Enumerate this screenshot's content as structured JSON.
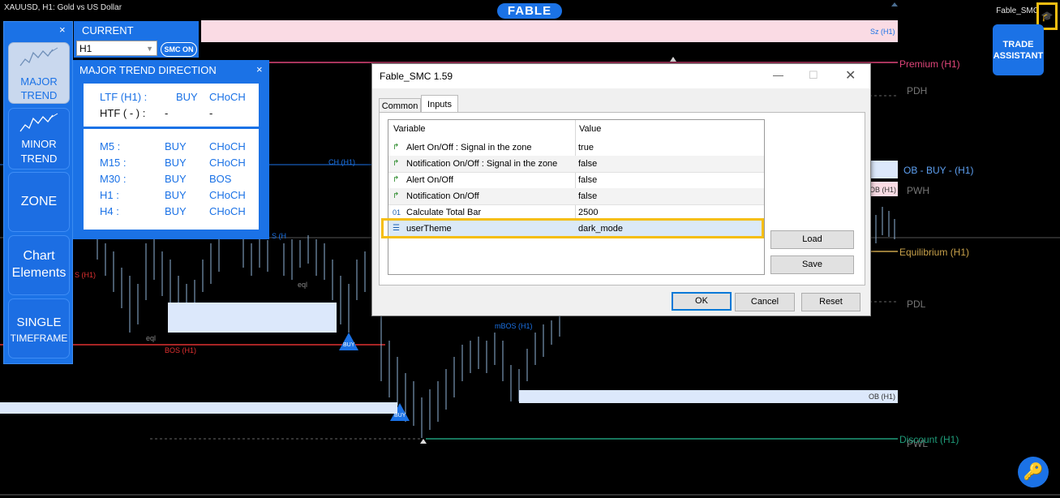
{
  "chart_header": {
    "symbol": "XAUUSD, H1:  Gold vs US Dollar",
    "indicator_name": "Fable_SMC"
  },
  "brand": "FABLE",
  "trade_assistant": "TRADE ASSISTANT",
  "sidebar": {
    "close": "×",
    "buttons": [
      {
        "label1": "MAJOR",
        "label2": "TREND"
      },
      {
        "label1": "MINOR",
        "label2": "TREND"
      },
      {
        "label1": "ZONE"
      },
      {
        "label1": "Chart",
        "label2": "Elements"
      },
      {
        "label1": "SINGLE",
        "label2": "TIMEFRAME"
      }
    ]
  },
  "current_panel": {
    "title": "CURRENT",
    "timeframe": "H1",
    "toggle": "SMC ON"
  },
  "major_trend": {
    "title": "MAJOR TREND DIRECTION",
    "close": "×",
    "top_rows": [
      {
        "tf": "LTF (H1) :",
        "dir": "BUY",
        "type": "CHoCH"
      },
      {
        "tf": "HTF ( - ) :",
        "dir": "-",
        "type": "-"
      }
    ],
    "rows": [
      {
        "tf": "M5 :",
        "dir": "BUY",
        "type": "CHoCH"
      },
      {
        "tf": "M15 :",
        "dir": "BUY",
        "type": "CHoCH"
      },
      {
        "tf": "M30 :",
        "dir": "BUY",
        "type": "BOS"
      },
      {
        "tf": "H1 :",
        "dir": "BUY",
        "type": "CHoCH"
      },
      {
        "tf": "H4 :",
        "dir": "BUY",
        "type": "CHoCH"
      }
    ]
  },
  "chart_labels": {
    "sz": "Sz (H1)",
    "premium": "Premium (H1)",
    "pdh": "PDH",
    "ob_buy": "OB - BUY -  (H1)",
    "ob_h1_small": "OB (H1)",
    "pwh": "PWH",
    "equilibrium": "Equilibrium (H1)",
    "pdl": "PDL",
    "ob_h1": "OB (H1)",
    "discount": "Discount (H1)",
    "pwl": "PWL",
    "ch_h1": "CH (H1)",
    "s_h1": "S (H1)",
    "bos_h1": "BOS (H1)",
    "mbos_h1": "mBOS (H1)",
    "eql1": "eql",
    "eql2": "eql",
    "buy1": "BUY",
    "buy2": "BUY",
    "sh": "S (H"
  },
  "dialog": {
    "title": "Fable_SMC 1.59",
    "tabs": [
      "Common",
      "Inputs"
    ],
    "columns": [
      "Variable",
      "Value"
    ],
    "params": [
      {
        "icon": "arrow-param-icon",
        "glyph": "↱",
        "name": "Alert On/Off : Signal in the zone",
        "value": "true"
      },
      {
        "icon": "arrow-param-icon",
        "glyph": "↱",
        "name": "Notification On/Off : Signal in the zone",
        "value": "false"
      },
      {
        "icon": "arrow-param-icon",
        "glyph": "↱",
        "name": "Alert On/Off",
        "value": "false"
      },
      {
        "icon": "arrow-param-icon",
        "glyph": "↱",
        "name": "Notification On/Off",
        "value": "false"
      },
      {
        "icon": "number-param-icon",
        "glyph": "01",
        "name": "Calculate Total Bar",
        "value": "2500"
      },
      {
        "icon": "enum-param-icon",
        "glyph": "☰",
        "name": "userTheme",
        "value": "dark_mode"
      }
    ],
    "load": "Load",
    "save": "Save",
    "ok": "OK",
    "cancel": "Cancel",
    "reset": "Reset"
  },
  "colors": {
    "accent": "#1b72e6",
    "highlight": "#f5be12",
    "premium": "#e0457a",
    "discount": "#1f9c7a",
    "bos": "#e03030",
    "equilibrium": "#c9a24a"
  }
}
